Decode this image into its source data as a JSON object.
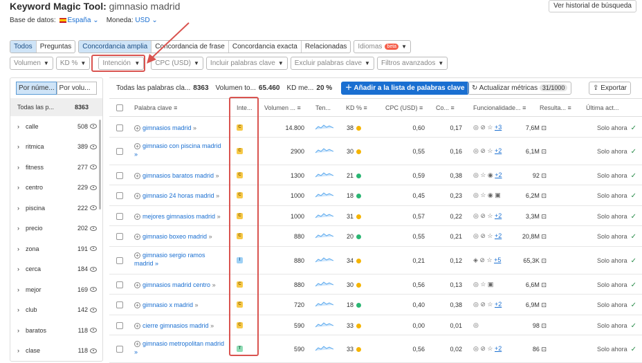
{
  "header": {
    "tool_name": "Keyword Magic Tool:",
    "query": "gimnasio madrid",
    "history_button": "Ver historial de búsqueda",
    "database_label": "Base de datos:",
    "database_value": "España",
    "currency_label": "Moneda:",
    "currency_value": "USD"
  },
  "filters1": {
    "all": "Todos",
    "questions": "Preguntas",
    "broad": "Concordancia amplia",
    "phrase": "Concordancia de frase",
    "exact": "Concordancia exacta",
    "related": "Relacionadas",
    "languages": "Idiomas",
    "beta": "beta"
  },
  "filters2": {
    "volume": "Volumen",
    "kd": "KD %",
    "intent": "Intención",
    "cpc": "CPC (USD)",
    "include": "Incluir palabras clave",
    "exclude": "Excluir palabras clave",
    "advanced": "Filtros avanzados"
  },
  "sidebar": {
    "tab_number": "Por núme...",
    "tab_volume": "Por volu...",
    "all_label": "Todas las p...",
    "all_count": "8363",
    "items": [
      {
        "word": "calle",
        "count": "508"
      },
      {
        "word": "ritmica",
        "count": "389"
      },
      {
        "word": "fitness",
        "count": "277"
      },
      {
        "word": "centro",
        "count": "229"
      },
      {
        "word": "piscina",
        "count": "222"
      },
      {
        "word": "precio",
        "count": "202"
      },
      {
        "word": "zona",
        "count": "191"
      },
      {
        "word": "cerca",
        "count": "184"
      },
      {
        "word": "mejor",
        "count": "169"
      },
      {
        "word": "club",
        "count": "142"
      },
      {
        "word": "baratos",
        "count": "118"
      },
      {
        "word": "clase",
        "count": "118"
      }
    ]
  },
  "toolbar": {
    "all_label": "Todas las palabras cla...",
    "all_count": "8363",
    "volume_label": "Volumen to...",
    "volume_value": "65.460",
    "kd_label": "KD me...",
    "kd_value": "20 %",
    "add_button": "Añadir a la lista de palabras clave",
    "update_button": "Actualizar métricas",
    "update_count": "31/1000",
    "export_button": "Exportar"
  },
  "columns": {
    "keyword": "Palabra clave",
    "intent": "Inte...",
    "volume": "Volumen ...",
    "trend": "Ten...",
    "kd": "KD %",
    "cpc": "CPC (USD)",
    "com": "Co...",
    "features": "Funcionalidade...",
    "results": "Resulta...",
    "last": "Última act..."
  },
  "rows": [
    {
      "kw1": "gimnasios madrid",
      "kw2": "",
      "intent": "C",
      "vol": "14.800",
      "kd": "38",
      "kdc": "#f5b400",
      "cpc": "0,60",
      "com": "0,17",
      "feat": "◎ ⊘ ☆",
      "more": "+3",
      "res": "7,6M",
      "last": "Solo ahora"
    },
    {
      "kw1": "gimnasio con piscina madrid",
      "kw2": "»",
      "intent": "C",
      "vol": "2900",
      "kd": "30",
      "kdc": "#f5b400",
      "cpc": "0,55",
      "com": "0,16",
      "feat": "◎ ⊘ ☆",
      "more": "+2",
      "res": "6,1M",
      "last": "Solo ahora"
    },
    {
      "kw1": "gimnasios baratos madrid",
      "kw2": "",
      "intent": "C",
      "vol": "1300",
      "kd": "21",
      "kdc": "#2bb673",
      "cpc": "0,59",
      "com": "0,38",
      "feat": "◎ ☆ ◉",
      "more": "+2",
      "res": "92",
      "last": "Solo ahora"
    },
    {
      "kw1": "gimnasio 24 horas madrid",
      "kw2": "",
      "intent": "C",
      "vol": "1000",
      "kd": "18",
      "kdc": "#2bb673",
      "cpc": "0,45",
      "com": "0,23",
      "feat": "◎ ☆ ◉ ▣",
      "more": "",
      "res": "6,2M",
      "last": "Solo ahora"
    },
    {
      "kw1": "mejores gimnasios madrid",
      "kw2": "",
      "intent": "C",
      "vol": "1000",
      "kd": "31",
      "kdc": "#f5b400",
      "cpc": "0,57",
      "com": "0,22",
      "feat": "◎ ⊘ ☆",
      "more": "+2",
      "res": "3,3M",
      "last": "Solo ahora"
    },
    {
      "kw1": "gimnasio boxeo madrid",
      "kw2": "",
      "intent": "C",
      "vol": "880",
      "kd": "20",
      "kdc": "#2bb673",
      "cpc": "0,55",
      "com": "0,21",
      "feat": "◎ ⊘ ☆",
      "more": "+2",
      "res": "20,8M",
      "last": "Solo ahora"
    },
    {
      "kw1": "gimnasio sergio ramos",
      "kw2": "madrid »",
      "intent": "I",
      "vol": "880",
      "kd": "34",
      "kdc": "#f5b400",
      "cpc": "0,21",
      "com": "0,12",
      "feat": "◈ ⊘ ☆",
      "more": "+5",
      "res": "65,3K",
      "last": "Solo ahora"
    },
    {
      "kw1": "gimnasios madrid centro",
      "kw2": "",
      "intent": "C",
      "vol": "880",
      "kd": "30",
      "kdc": "#f5b400",
      "cpc": "0,56",
      "com": "0,13",
      "feat": "◎ ☆ ▣",
      "more": "",
      "res": "6,6M",
      "last": "Solo ahora"
    },
    {
      "kw1": "gimnasio x madrid",
      "kw2": "",
      "intent": "C",
      "vol": "720",
      "kd": "18",
      "kdc": "#2bb673",
      "cpc": "0,40",
      "com": "0,38",
      "feat": "◎ ⊘ ☆",
      "more": "+2",
      "res": "6,9M",
      "last": "Solo ahora"
    },
    {
      "kw1": "cierre gimnasios madrid",
      "kw2": "",
      "intent": "C",
      "vol": "590",
      "kd": "33",
      "kdc": "#f5b400",
      "cpc": "0,00",
      "com": "0,01",
      "feat": "◎",
      "more": "",
      "res": "98",
      "last": "Solo ahora"
    },
    {
      "kw1": "gimnasio metropolitan madrid",
      "kw2": "»",
      "intent": "T",
      "vol": "590",
      "kd": "33",
      "kdc": "#f5b400",
      "cpc": "0,56",
      "com": "0,02",
      "feat": "◎ ⊘ ☆",
      "more": "+2",
      "res": "86",
      "last": "Solo ahora"
    }
  ]
}
